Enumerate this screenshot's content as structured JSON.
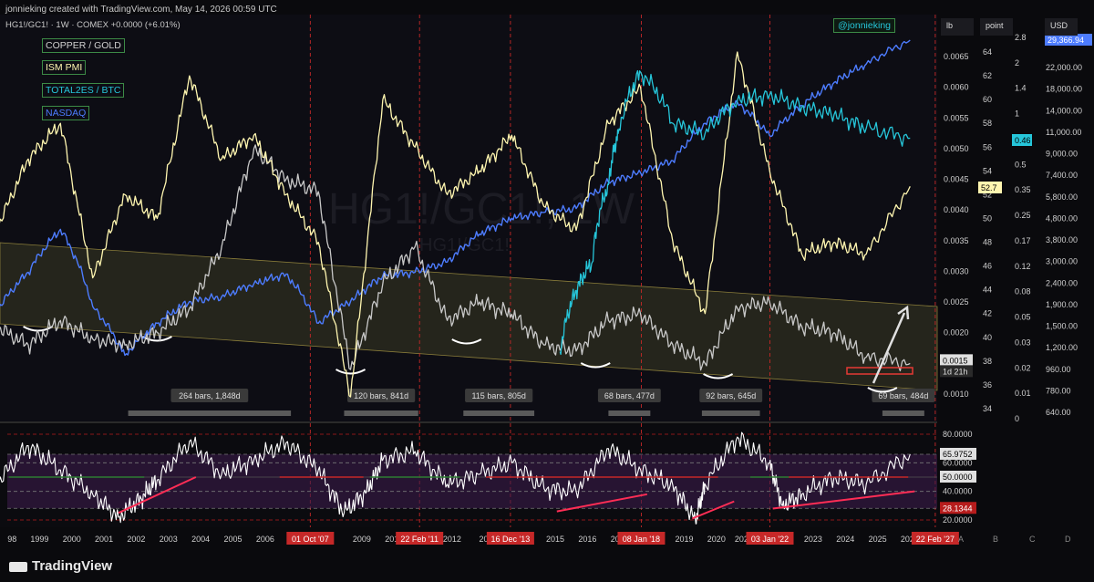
{
  "header": {
    "credit": "jonnieking created with TradingView.com, May 14, 2026 00:59 UTC",
    "symbol_line": "HG1!/GC1! · 1W · COMEX  +0.0000 (+6.01%)",
    "handle": "@jonnieking",
    "scale_headers": [
      "lb",
      "point",
      "USD"
    ]
  },
  "legend": [
    {
      "label": "COPPER / GOLD",
      "color": "#d0d0d0"
    },
    {
      "label": "ISM PMI",
      "color": "#fff6b0"
    },
    {
      "label": "TOTAL2ES / BTC",
      "color": "#26c6da"
    },
    {
      "label": "NASDAQ",
      "color": "#4d7cff"
    }
  ],
  "watermark": {
    "big": "HG1!/GC1!, 1W",
    "small": "HG1!/GC1!"
  },
  "colors": {
    "copper_gold": "#c8c8c8",
    "ism": "#fff6b0",
    "total2es": "#26c6da",
    "nasdaq": "#4d7cff",
    "rsi": "#ffffff",
    "rsi_band": "#3a1a4a",
    "channel": "#3a3a22",
    "marker": "#e53935"
  },
  "chart_data": [
    {
      "type": "line",
      "title": "HG1!/GC1! · 1W · COMEX",
      "series": [
        {
          "name": "COPPER / GOLD",
          "x": [
            1998,
            1999,
            2000,
            2001,
            2002,
            2003,
            2004,
            2005,
            2006,
            2007,
            2008,
            2009,
            2010,
            2011,
            2012,
            2013,
            2014,
            2015,
            2016,
            2017,
            2018,
            2019,
            2020,
            2021,
            2022,
            2023,
            2024,
            2025,
            2026.36
          ],
          "values": [
            0.0021,
            0.0018,
            0.0022,
            0.0019,
            0.0018,
            0.002,
            0.0024,
            0.0034,
            0.005,
            0.0045,
            0.0043,
            0.0014,
            0.0028,
            0.0034,
            0.0022,
            0.0025,
            0.0023,
            0.0018,
            0.0017,
            0.0022,
            0.0023,
            0.0018,
            0.0015,
            0.0024,
            0.0025,
            0.0021,
            0.002,
            0.0016,
            0.0015
          ]
        },
        {
          "name": "ISM PMI",
          "x": [
            1998,
            1999,
            2000,
            2001,
            2002,
            2003,
            2004,
            2005,
            2006,
            2007,
            2008,
            2009,
            2010,
            2011,
            2012,
            2013,
            2014,
            2015,
            2016,
            2017,
            2018,
            2019,
            2020,
            2021,
            2022,
            2023,
            2024,
            2025,
            2026.36
          ],
          "values": [
            49,
            55,
            58,
            45,
            52,
            50,
            62,
            55,
            57,
            52,
            48,
            35,
            60,
            56,
            52,
            54,
            57,
            51,
            49,
            58,
            61,
            48,
            42,
            64,
            54,
            47,
            48,
            47,
            52.7
          ]
        },
        {
          "name": "TOTAL2ES / BTC",
          "x": [
            2015.5,
            2016,
            2016.5,
            2017,
            2017.3,
            2018,
            2019,
            2020,
            2021,
            2022,
            2023,
            2024,
            2025,
            2026.36
          ],
          "values": [
            0.01,
            0.03,
            0.05,
            0.2,
            0.5,
            1.5,
            0.6,
            0.5,
            0.9,
            1.0,
            0.8,
            0.7,
            0.55,
            0.46
          ]
        },
        {
          "name": "NASDAQ",
          "x": [
            1998,
            1999,
            2000,
            2001,
            2002,
            2003,
            2004,
            2005,
            2006,
            2007,
            2008,
            2009,
            2010,
            2011,
            2012,
            2013,
            2014,
            2015,
            2016,
            2017,
            2018,
            2019,
            2020,
            2021,
            2022,
            2023,
            2024,
            2025,
            2026.36
          ],
          "values": [
            1800,
            2700,
            4200,
            1900,
            1150,
            1600,
            2000,
            2100,
            2400,
            2650,
            1600,
            2000,
            2600,
            2700,
            3000,
            4000,
            4700,
            5000,
            5200,
            6800,
            7500,
            8500,
            12500,
            15500,
            11000,
            15000,
            19000,
            23000,
            29366.94
          ]
        }
      ],
      "axes": {
        "copper_gold": {
          "ticks": [
            0.001,
            0.0015,
            0.002,
            0.0025,
            0.003,
            0.0035,
            0.004,
            0.0045,
            0.005,
            0.0055,
            0.006,
            0.0065
          ],
          "labels": [
            "0.0010",
            "0.0015",
            "0.0020",
            "0.0025",
            "0.0030",
            "0.0035",
            "0.0040",
            "0.0045",
            "0.0050",
            "0.0055",
            "0.0060",
            "0.0065"
          ]
        },
        "ism": {
          "ticks": [
            34,
            36,
            38,
            40,
            42,
            44,
            46,
            48,
            50,
            52,
            54,
            56,
            58,
            60,
            62,
            64
          ],
          "labels": [
            "34",
            "36",
            "38",
            "40",
            "42",
            "44",
            "46",
            "48",
            "50",
            "52",
            "54",
            "56",
            "58",
            "60",
            "62",
            "64"
          ]
        },
        "total2es": {
          "labels": [
            "0",
            "0.01",
            "0.02",
            "0.03",
            "0.05",
            "0.08",
            "0.12",
            "0.17",
            "0.25",
            "0.35",
            "0.5",
            "0.7",
            "1",
            "1.4",
            "2",
            "2.8"
          ]
        },
        "nasdaq": {
          "labels": [
            "640.00",
            "780.00",
            "960.00",
            "1,200.00",
            "1,500.00",
            "1,900.00",
            "2,400.00",
            "3,000.00",
            "3,800.00",
            "4,800.00",
            "5,800.00",
            "7,400.00",
            "9,000.00",
            "11,000.00",
            "14,000.00",
            "18,000.00",
            "22,000.00"
          ]
        }
      },
      "price_tags": [
        {
          "text": "29,366.94",
          "series": "NASDAQ"
        },
        {
          "text": "0.46",
          "series": "TOTAL2ES / BTC"
        },
        {
          "text": "52.7",
          "series": "ISM PMI"
        },
        {
          "text": "0.0015",
          "series": "COPPER / GOLD"
        },
        {
          "text": "1d 21h",
          "series": "COPPER / GOLD"
        }
      ],
      "cycle_labels": [
        "264 bars, 1,848d",
        "120 bars, 841d",
        "115 bars, 805d",
        "68 bars, 477d",
        "92 bars, 645d",
        "69 bars, 484d"
      ]
    },
    {
      "type": "line",
      "series": [
        {
          "name": "RSI",
          "x": [
            1998,
            1999,
            2000,
            2001,
            2001.8,
            2002.5,
            2003,
            2004,
            2005,
            2006,
            2007,
            2008,
            2008.8,
            2009.5,
            2010,
            2011,
            2012,
            2013,
            2014,
            2015,
            2016,
            2017,
            2018,
            2019,
            2019.7,
            2020,
            2021,
            2022,
            2022.4,
            2023,
            2024,
            2025,
            2026.36
          ],
          "values": [
            45,
            72,
            55,
            38,
            22,
            35,
            48,
            75,
            52,
            62,
            74,
            55,
            25,
            40,
            62,
            68,
            45,
            52,
            60,
            42,
            40,
            70,
            55,
            44,
            20,
            45,
            78,
            60,
            30,
            38,
            50,
            45,
            65.9752
          ]
        }
      ],
      "levels": [
        20,
        28.1344,
        40,
        50,
        60,
        65.9752,
        80
      ],
      "level_labels": [
        "80.0000",
        "65.9752",
        "60.0000",
        "50.0000",
        "40.0000",
        "28.1344",
        "20.0000"
      ]
    }
  ],
  "time_axis": {
    "years": [
      "98",
      "1999",
      "2000",
      "2001",
      "2002",
      "2003",
      "2004",
      "2005",
      "2006",
      "20",
      "2009",
      "2010",
      "2011",
      "2012",
      "201",
      "2014",
      "2015",
      "2016",
      "2017",
      "2018",
      "2019",
      "2020",
      "2021",
      "2022",
      "2023",
      "2024",
      "2025",
      "2026",
      "2027"
    ],
    "red_markers": [
      "01 Oct '07",
      "22 Feb '11",
      "16 Dec '13",
      "08 Jan '18",
      "03 Jan '22",
      "22 Feb '27"
    ],
    "scale_letters": [
      "A",
      "B",
      "C",
      "D"
    ]
  },
  "footer": {
    "brand": "TradingView"
  }
}
